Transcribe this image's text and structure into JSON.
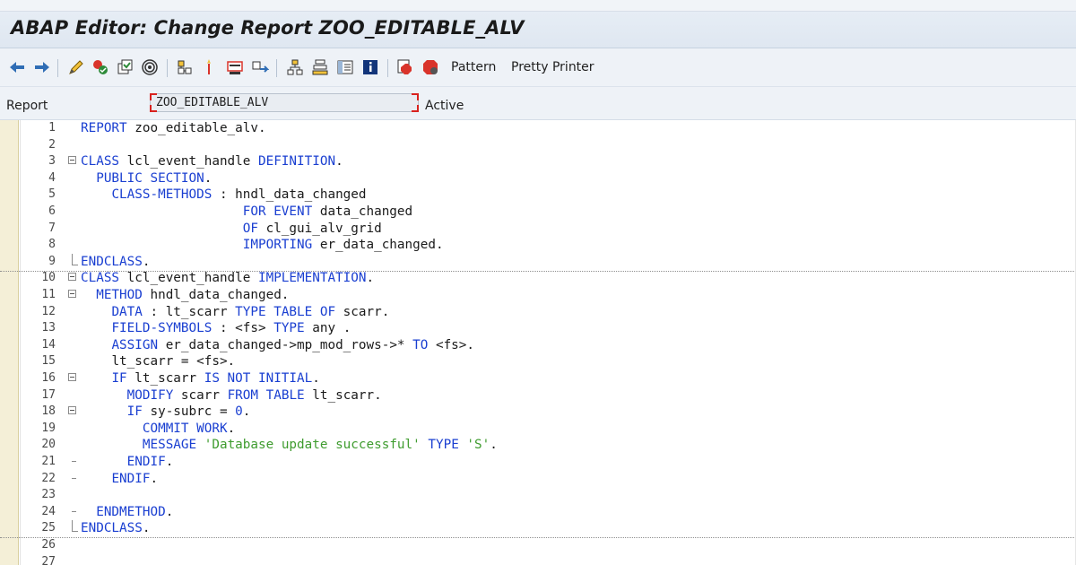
{
  "window": {
    "title": "ABAP Editor: Change Report ZOO_EDITABLE_ALV"
  },
  "toolbar": {
    "buttons": [
      {
        "name": "back-arrow-icon"
      },
      {
        "name": "forward-arrow-icon"
      },
      {
        "name": "other-object-icon"
      },
      {
        "name": "check-syntax-icon"
      },
      {
        "name": "activate-icon"
      },
      {
        "name": "test-icon"
      },
      {
        "name": "where-used-icon"
      },
      {
        "name": "object-list-icon"
      },
      {
        "name": "display-navigation-icon"
      },
      {
        "name": "enhance-icon"
      },
      {
        "name": "hierarchy-icon"
      },
      {
        "name": "stack-icon"
      },
      {
        "name": "layout-icon"
      },
      {
        "name": "information-icon"
      },
      {
        "name": "set-breakpoint-icon"
      },
      {
        "name": "session-breakpoint-icon"
      }
    ],
    "pattern_label": "Pattern",
    "pretty_printer_label": "Pretty Printer"
  },
  "report": {
    "label": "Report",
    "value": "ZOO_EDITABLE_ALV",
    "status": "Active"
  },
  "code_lines": [
    {
      "num": "1",
      "indent": "",
      "tokens": [
        [
          "kw",
          "REPORT"
        ],
        [
          "t",
          " zoo_editable_alv."
        ]
      ]
    },
    {
      "num": "2",
      "indent": "",
      "tokens": []
    },
    {
      "num": "3",
      "indent": "",
      "fold": "open",
      "tokens": [
        [
          "kw",
          "CLASS"
        ],
        [
          "t",
          " lcl_event_handle "
        ],
        [
          "kw",
          "DEFINITION"
        ],
        [
          "t",
          "."
        ]
      ]
    },
    {
      "num": "4",
      "indent": "  ",
      "tokens": [
        [
          "kw",
          "PUBLIC SECTION"
        ],
        [
          "t",
          "."
        ]
      ]
    },
    {
      "num": "5",
      "indent": "    ",
      "tokens": [
        [
          "kw",
          "CLASS-METHODS"
        ],
        [
          "t",
          " : hndl_data_changed"
        ]
      ]
    },
    {
      "num": "6",
      "indent": "                     ",
      "tokens": [
        [
          "kw",
          "FOR EVENT"
        ],
        [
          "t",
          " data_changed"
        ]
      ]
    },
    {
      "num": "7",
      "indent": "                     ",
      "tokens": [
        [
          "kw",
          "OF"
        ],
        [
          "t",
          " cl_gui_alv_grid"
        ]
      ]
    },
    {
      "num": "8",
      "indent": "                     ",
      "tokens": [
        [
          "kw",
          "IMPORTING"
        ],
        [
          "t",
          " er_data_changed."
        ]
      ]
    },
    {
      "num": "9",
      "indent": "",
      "fold": "end",
      "sep": true,
      "tokens": [
        [
          "kw",
          "ENDCLASS"
        ],
        [
          "t",
          "."
        ]
      ]
    },
    {
      "num": "10",
      "indent": "",
      "fold": "open",
      "tokens": [
        [
          "kw",
          "CLASS"
        ],
        [
          "t",
          " lcl_event_handle "
        ],
        [
          "kw",
          "IMPLEMENTATION"
        ],
        [
          "t",
          "."
        ]
      ]
    },
    {
      "num": "11",
      "indent": "  ",
      "fold": "open",
      "tokens": [
        [
          "kw",
          "METHOD"
        ],
        [
          "t",
          " hndl_data_changed."
        ]
      ]
    },
    {
      "num": "12",
      "indent": "    ",
      "tokens": [
        [
          "kw",
          "DATA"
        ],
        [
          "t",
          " : lt_scarr "
        ],
        [
          "kw",
          "TYPE TABLE OF"
        ],
        [
          "t",
          " scarr."
        ]
      ]
    },
    {
      "num": "13",
      "indent": "    ",
      "tokens": [
        [
          "kw",
          "FIELD-SYMBOLS"
        ],
        [
          "t",
          " : <fs> "
        ],
        [
          "kw",
          "TYPE"
        ],
        [
          "t",
          " any ."
        ]
      ]
    },
    {
      "num": "14",
      "indent": "    ",
      "tokens": [
        [
          "kw",
          "ASSIGN"
        ],
        [
          "t",
          " er_data_changed->mp_mod_rows->* "
        ],
        [
          "kw",
          "TO"
        ],
        [
          "t",
          " <fs>."
        ]
      ]
    },
    {
      "num": "15",
      "indent": "    ",
      "tokens": [
        [
          "t",
          "lt_scarr = <fs>."
        ]
      ]
    },
    {
      "num": "16",
      "indent": "    ",
      "fold": "open",
      "tokens": [
        [
          "kw",
          "IF"
        ],
        [
          "t",
          " lt_scarr "
        ],
        [
          "kw",
          "IS NOT INITIAL"
        ],
        [
          "t",
          "."
        ]
      ]
    },
    {
      "num": "17",
      "indent": "      ",
      "tokens": [
        [
          "kw",
          "MODIFY"
        ],
        [
          "t",
          " scarr "
        ],
        [
          "kw",
          "FROM TABLE"
        ],
        [
          "t",
          " lt_scarr."
        ]
      ]
    },
    {
      "num": "18",
      "indent": "      ",
      "fold": "open",
      "tokens": [
        [
          "kw",
          "IF"
        ],
        [
          "t",
          " sy-subrc = "
        ],
        [
          "num",
          "0"
        ],
        [
          "t",
          "."
        ]
      ]
    },
    {
      "num": "19",
      "indent": "        ",
      "tokens": [
        [
          "kw",
          "COMMIT WORK"
        ],
        [
          "t",
          "."
        ]
      ]
    },
    {
      "num": "20",
      "indent": "        ",
      "tokens": [
        [
          "kw",
          "MESSAGE"
        ],
        [
          "t",
          " "
        ],
        [
          "str",
          "'Database update successful'"
        ],
        [
          "t",
          " "
        ],
        [
          "kw",
          "TYPE"
        ],
        [
          "t",
          " "
        ],
        [
          "str",
          "'S'"
        ],
        [
          "t",
          "."
        ]
      ]
    },
    {
      "num": "21",
      "indent": "      ",
      "fold": "mid",
      "tokens": [
        [
          "kw",
          "ENDIF"
        ],
        [
          "t",
          "."
        ]
      ]
    },
    {
      "num": "22",
      "indent": "    ",
      "fold": "mid",
      "tokens": [
        [
          "kw",
          "ENDIF"
        ],
        [
          "t",
          "."
        ]
      ]
    },
    {
      "num": "23",
      "indent": "",
      "tokens": []
    },
    {
      "num": "24",
      "indent": "  ",
      "fold": "mid",
      "tokens": [
        [
          "kw",
          "ENDMETHOD"
        ],
        [
          "t",
          "."
        ]
      ]
    },
    {
      "num": "25",
      "indent": "",
      "fold": "end",
      "sep": true,
      "tokens": [
        [
          "kw",
          "ENDCLASS"
        ],
        [
          "t",
          "."
        ]
      ]
    },
    {
      "num": "26",
      "indent": "",
      "tokens": []
    },
    {
      "num": "27",
      "indent": "",
      "tokens": []
    }
  ],
  "colors": {
    "keyword": "#1a3fd1",
    "string": "#3f9c2f",
    "text": "#1a1a1a"
  }
}
